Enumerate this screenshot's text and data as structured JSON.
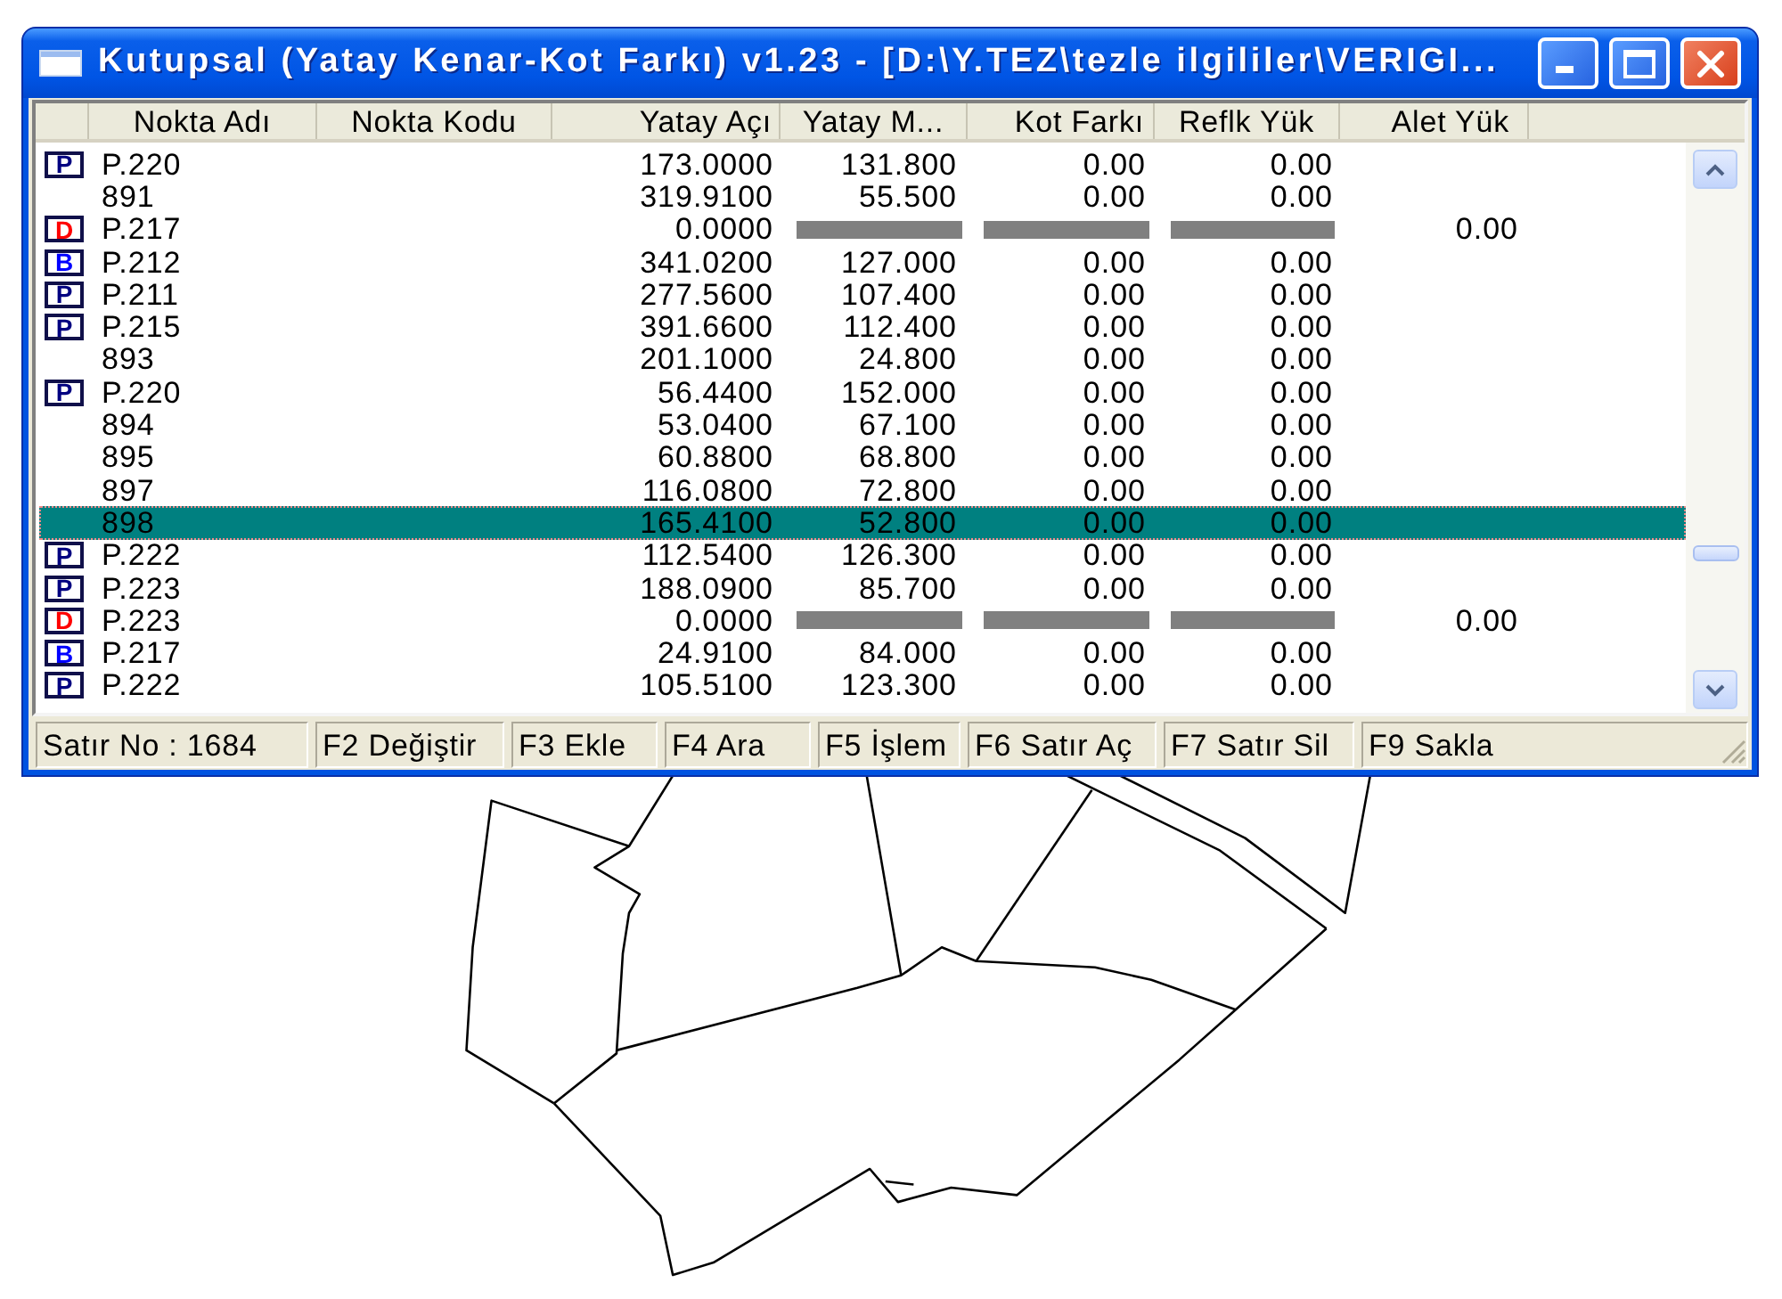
{
  "window": {
    "title": "Kutupsal (Yatay Kenar-Kot Farkı) v1.23 - [D:\\Y.TEZ\\tezle ilgililer\\VERIGI..."
  },
  "table": {
    "columns": [
      "Nokta Adı",
      "Nokta Kodu",
      "Yatay Açı",
      "Yatay M...",
      "Kot Farkı",
      "Reflk Yük",
      "Alet Yük"
    ],
    "rows": [
      {
        "kind": "observation",
        "badge": {
          "letter": "P",
          "color": "#000080"
        },
        "nokta_adi": "P.220",
        "yatay_aci": "173.0000",
        "yatay_m": "131.800",
        "kot_farki": "0.00",
        "reflk_yuk": "0.00",
        "selected": false
      },
      {
        "kind": "observation",
        "nokta_adi": "891",
        "yatay_aci": "319.9100",
        "yatay_m": "55.500",
        "kot_farki": "0.00",
        "reflk_yuk": "0.00",
        "selected": false
      },
      {
        "kind": "station",
        "badge": {
          "letter": "D",
          "color": "#ff0000"
        },
        "nokta_adi": "P.217",
        "yatay_aci": "0.0000",
        "alet_yuk": "0.00",
        "selected": false
      },
      {
        "kind": "observation",
        "badge": {
          "letter": "B",
          "color": "#0000ff"
        },
        "nokta_adi": "P.212",
        "yatay_aci": "341.0200",
        "yatay_m": "127.000",
        "kot_farki": "0.00",
        "reflk_yuk": "0.00",
        "selected": false
      },
      {
        "kind": "observation",
        "badge": {
          "letter": "P",
          "color": "#000080"
        },
        "nokta_adi": "P.211",
        "yatay_aci": "277.5600",
        "yatay_m": "107.400",
        "kot_farki": "0.00",
        "reflk_yuk": "0.00",
        "selected": false
      },
      {
        "kind": "observation",
        "badge": {
          "letter": "P",
          "color": "#000080"
        },
        "nokta_adi": "P.215",
        "yatay_aci": "391.6600",
        "yatay_m": "112.400",
        "kot_farki": "0.00",
        "reflk_yuk": "0.00",
        "selected": false
      },
      {
        "kind": "observation",
        "nokta_adi": "893",
        "yatay_aci": "201.1000",
        "yatay_m": "24.800",
        "kot_farki": "0.00",
        "reflk_yuk": "0.00",
        "selected": false
      },
      {
        "kind": "observation",
        "badge": {
          "letter": "P",
          "color": "#000080"
        },
        "nokta_adi": "P.220",
        "yatay_aci": "56.4400",
        "yatay_m": "152.000",
        "kot_farki": "0.00",
        "reflk_yuk": "0.00",
        "selected": false
      },
      {
        "kind": "observation",
        "nokta_adi": "894",
        "yatay_aci": "53.0400",
        "yatay_m": "67.100",
        "kot_farki": "0.00",
        "reflk_yuk": "0.00",
        "selected": false
      },
      {
        "kind": "observation",
        "nokta_adi": "895",
        "yatay_aci": "60.8800",
        "yatay_m": "68.800",
        "kot_farki": "0.00",
        "reflk_yuk": "0.00",
        "selected": false
      },
      {
        "kind": "observation",
        "nokta_adi": "897",
        "yatay_aci": "116.0800",
        "yatay_m": "72.800",
        "kot_farki": "0.00",
        "reflk_yuk": "0.00",
        "selected": false
      },
      {
        "kind": "observation",
        "nokta_adi": "898",
        "yatay_aci": "165.4100",
        "yatay_m": "52.800",
        "kot_farki": "0.00",
        "reflk_yuk": "0.00",
        "selected": true
      },
      {
        "kind": "observation",
        "badge": {
          "letter": "P",
          "color": "#000080"
        },
        "nokta_adi": "P.222",
        "yatay_aci": "112.5400",
        "yatay_m": "126.300",
        "kot_farki": "0.00",
        "reflk_yuk": "0.00",
        "selected": false
      },
      {
        "kind": "observation",
        "badge": {
          "letter": "P",
          "color": "#000080"
        },
        "nokta_adi": "P.223",
        "yatay_aci": "188.0900",
        "yatay_m": "85.700",
        "kot_farki": "0.00",
        "reflk_yuk": "0.00",
        "selected": false
      },
      {
        "kind": "station",
        "badge": {
          "letter": "D",
          "color": "#ff0000"
        },
        "nokta_adi": "P.223",
        "yatay_aci": "0.0000",
        "alet_yuk": "0.00",
        "selected": false
      },
      {
        "kind": "observation",
        "badge": {
          "letter": "B",
          "color": "#0000ff"
        },
        "nokta_adi": "P.217",
        "yatay_aci": "24.9100",
        "yatay_m": "84.000",
        "kot_farki": "0.00",
        "reflk_yuk": "0.00",
        "selected": false
      },
      {
        "kind": "observation",
        "badge": {
          "letter": "P",
          "color": "#000080"
        },
        "nokta_adi": "P.222",
        "yatay_aci": "105.5100",
        "yatay_m": "123.300",
        "kot_farki": "0.00",
        "reflk_yuk": "0.00",
        "selected": false
      }
    ]
  },
  "status_bar": {
    "panels": [
      "Satır No : 1684",
      "F2 Değiştir",
      "F3 Ekle",
      "F4 Ara",
      "F5 İşlem",
      "F6 Satır Aç",
      "F7 Satır Sil",
      "F9 Sakla"
    ]
  }
}
